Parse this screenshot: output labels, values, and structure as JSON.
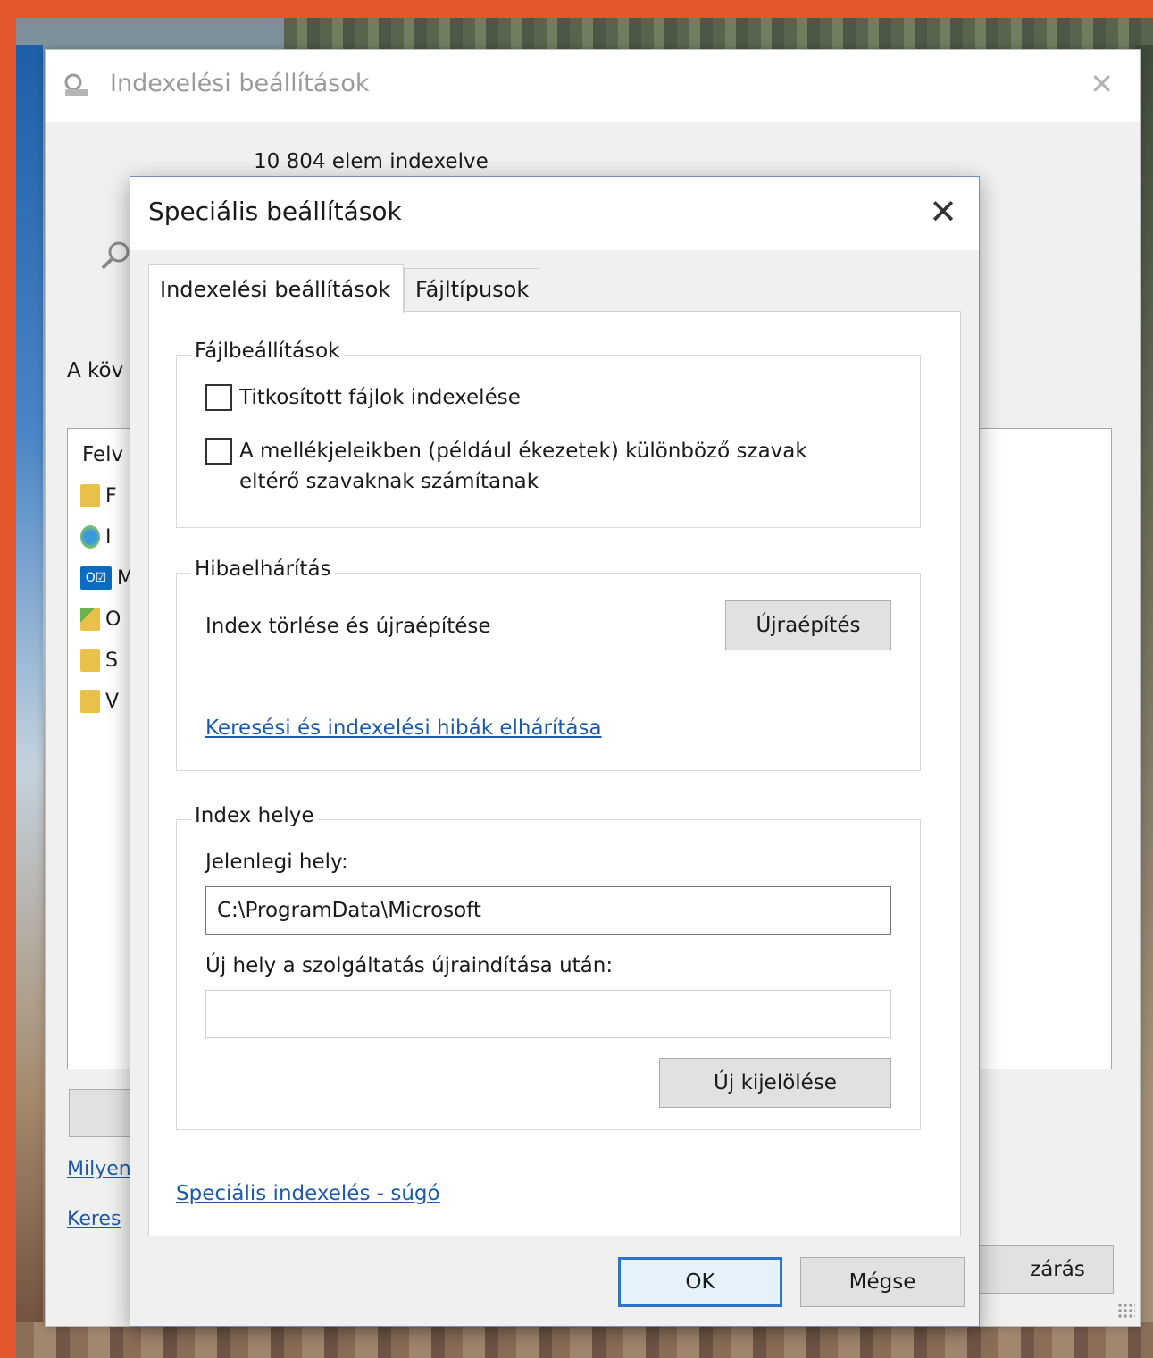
{
  "background_window": {
    "title": "Indexelési beállítások",
    "items_indexed": "10 804 elem indexelve",
    "label_fragment": "A köv",
    "list_header_fragment": "Felv",
    "list_items": [
      {
        "fragment": "F",
        "icon": "folder-icon"
      },
      {
        "fragment": "I",
        "icon": "internet-explorer-icon"
      },
      {
        "fragment": "M",
        "icon": "outlook-icon"
      },
      {
        "fragment": "O",
        "icon": "offline-files-icon"
      },
      {
        "fragment": "S",
        "icon": "folder-icon"
      },
      {
        "fragment": "V",
        "icon": "folder-icon"
      }
    ],
    "link1_fragment": "Milyen",
    "link2_fragment": "Keres",
    "close_button_fragment": "zárás"
  },
  "dialog": {
    "title": "Speciális beállítások",
    "tabs": [
      {
        "label": "Indexelési beállítások",
        "active": true
      },
      {
        "label": "Fájltípusok",
        "active": false
      }
    ],
    "file_settings": {
      "legend": "Fájlbeállítások",
      "checkbox1": {
        "label": "Titkosított fájlok indexelése",
        "checked": false
      },
      "checkbox2": {
        "label": "A mellékjeleikben (például ékezetek) különböző szavak eltérő szavaknak számítanak",
        "checked": false
      }
    },
    "troubleshooting": {
      "legend": "Hibaelhárítás",
      "rebuild_text": "Index törlése és újraépítése",
      "rebuild_button": "Újraépítés",
      "link": "Keresési és indexelési hibák elhárítása"
    },
    "index_location": {
      "legend": "Index helye",
      "current_label": "Jelenlegi hely:",
      "current_value": "C:\\ProgramData\\Microsoft",
      "new_label": "Új hely a szolgáltatás újraindítása után:",
      "new_value": "",
      "select_new_button": "Új kijelölése"
    },
    "help_link": "Speciális indexelés - súgó",
    "ok_button": "OK",
    "cancel_button": "Mégse"
  },
  "colors": {
    "frame": "#e4572e",
    "link": "#1e5aa8",
    "ok_border": "#2b74c8"
  }
}
